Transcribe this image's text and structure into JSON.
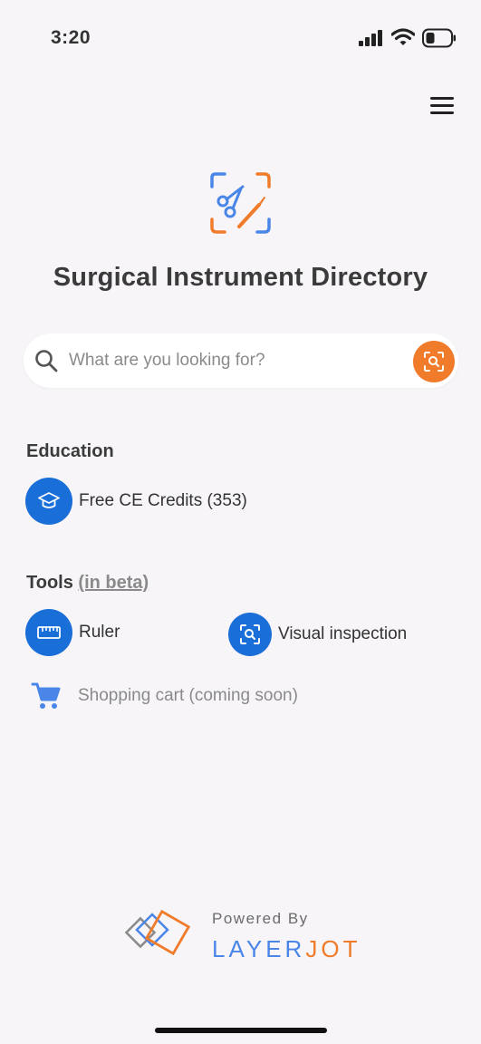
{
  "status_bar": {
    "time": "3:20",
    "icons": [
      "signal-icon",
      "wifi-icon",
      "battery-icon"
    ]
  },
  "header": {
    "menu_icon": "hamburger-menu-icon",
    "logo_icon": "scissors-scalpel-logo-icon",
    "title": "Surgical Instrument Directory"
  },
  "search": {
    "placeholder": "What are you looking for?",
    "value": "",
    "search_icon": "search-icon",
    "scan_icon": "camera-scan-icon"
  },
  "education": {
    "heading": "Education",
    "items": [
      {
        "label": "Free CE Credits (353)",
        "icon": "graduation-cap-icon"
      }
    ]
  },
  "tools": {
    "heading": "Tools",
    "beta_label": "(in beta)",
    "items": [
      {
        "label": "Ruler",
        "icon": "ruler-icon"
      },
      {
        "label": "Visual inspection",
        "icon": "visual-inspection-icon"
      },
      {
        "label": "Shopping cart (coming soon)",
        "icon": "shopping-cart-icon"
      }
    ]
  },
  "footer": {
    "powered_by": "Powered By",
    "brand_part1": "LAYER",
    "brand_part2": "JOT"
  },
  "colors": {
    "background": "#f7f5f8",
    "primary_blue": "#1a6ed8",
    "accent_orange": "#f07b2a",
    "brand_blue": "#4a86e8",
    "muted_text": "#8a8a8a"
  }
}
